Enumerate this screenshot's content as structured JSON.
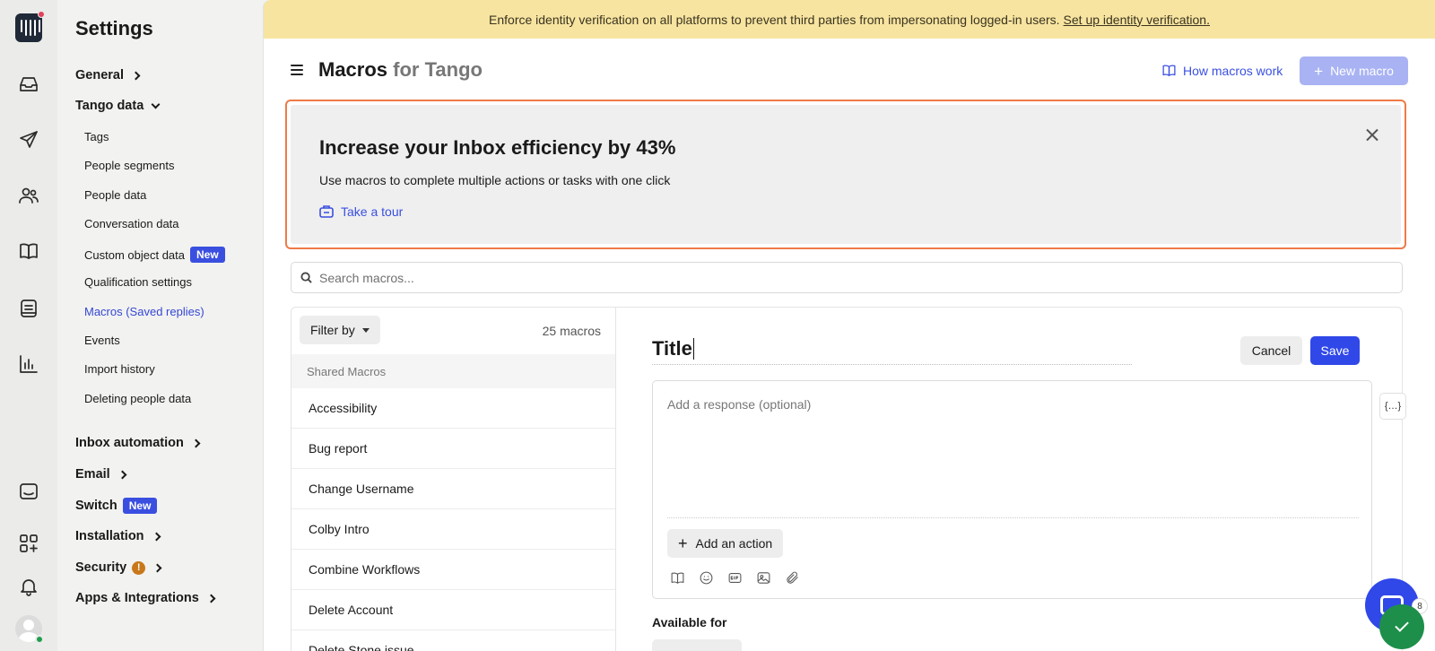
{
  "app": {
    "sidebar_title": "Settings"
  },
  "rail": {
    "icons": [
      "intercom-logo-icon",
      "inbox-icon",
      "outbound-icon",
      "contacts-icon",
      "knowledge-icon",
      "reports-list-icon",
      "analytics-icon",
      "messenger-icon",
      "apps-icon",
      "notifications-icon"
    ]
  },
  "sidebar": {
    "general": "General",
    "data_section": "Tango data",
    "data_items": [
      {
        "label": "Tags"
      },
      {
        "label": "People segments"
      },
      {
        "label": "People data"
      },
      {
        "label": "Conversation data"
      },
      {
        "label": "Custom object data",
        "badge": "New"
      },
      {
        "label": "Qualification settings"
      },
      {
        "label": "Macros (Saved replies)",
        "active": true
      },
      {
        "label": "Events"
      },
      {
        "label": "Import history"
      },
      {
        "label": "Deleting people data"
      }
    ],
    "inbox_automation": "Inbox automation",
    "email": "Email",
    "switch": "Switch",
    "switch_badge": "New",
    "installation": "Installation",
    "security": "Security",
    "security_alert": "!",
    "apps": "Apps & Integrations"
  },
  "banner": {
    "text": "Enforce identity verification on all platforms to prevent third parties from impersonating logged-in users.",
    "link": "Set up identity verification."
  },
  "header": {
    "title": "Macros",
    "title_suffix": "for Tango",
    "help_link": "How macros work",
    "new_button": "New macro"
  },
  "promo": {
    "heading": "Increase your Inbox efficiency by 43%",
    "body": "Use macros to complete multiple actions or tasks with one click",
    "tour": "Take a tour"
  },
  "search": {
    "placeholder": "Search macros..."
  },
  "list": {
    "filter_label": "Filter by",
    "count": "25 macros",
    "group": "Shared Macros",
    "items": [
      "Accessibility",
      "Bug report",
      "Change Username",
      "Colby Intro",
      "Combine Workflows",
      "Delete Account",
      "Delete Stone issue"
    ]
  },
  "editor": {
    "title_value": "Title",
    "cancel": "Cancel",
    "save": "Save",
    "response_placeholder": "Add a response (optional)",
    "add_action": "Add an action",
    "variable_button": "{…}",
    "available_for": "Available for"
  },
  "messenger": {
    "count": "8"
  },
  "colors": {
    "accent": "#3048e8",
    "banner_bg": "#f7e4a0",
    "promo_border": "#ee7a47",
    "success": "#1d8f4a"
  }
}
